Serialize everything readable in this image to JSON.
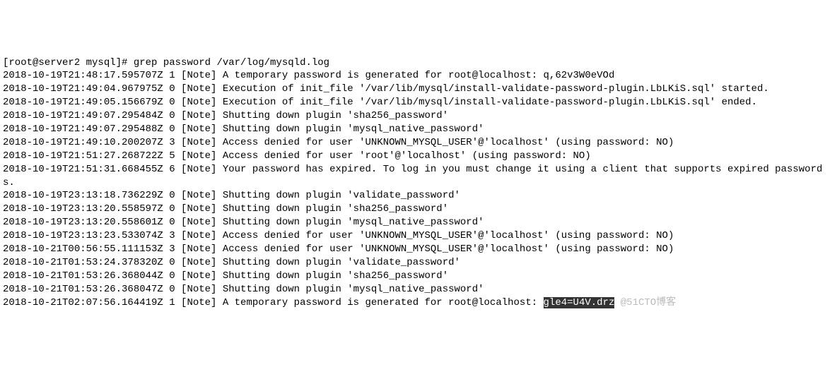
{
  "prompt": "[root@server2 mysql]# grep password /var/log/mysqld.log",
  "lines": [
    "2018-10-19T21:48:17.595707Z 1 [Note] A temporary password is generated for root@localhost: q,62v3W0eVOd",
    "2018-10-19T21:49:04.967975Z 0 [Note] Execution of init_file '/var/lib/mysql/install-validate-password-plugin.LbLKiS.sql' started.",
    "2018-10-19T21:49:05.156679Z 0 [Note] Execution of init_file '/var/lib/mysql/install-validate-password-plugin.LbLKiS.sql' ended.",
    "2018-10-19T21:49:07.295484Z 0 [Note] Shutting down plugin 'sha256_password'",
    "2018-10-19T21:49:07.295488Z 0 [Note] Shutting down plugin 'mysql_native_password'",
    "2018-10-19T21:49:10.200207Z 3 [Note] Access denied for user 'UNKNOWN_MYSQL_USER'@'localhost' (using password: NO)",
    "2018-10-19T21:51:27.268722Z 5 [Note] Access denied for user 'root'@'localhost' (using password: NO)",
    "2018-10-19T21:51:31.668455Z 6 [Note] Your password has expired. To log in you must change it using a client that supports expired passwords.",
    "2018-10-19T23:13:18.736229Z 0 [Note] Shutting down plugin 'validate_password'",
    "2018-10-19T23:13:20.558597Z 0 [Note] Shutting down plugin 'sha256_password'",
    "2018-10-19T23:13:20.558601Z 0 [Note] Shutting down plugin 'mysql_native_password'",
    "2018-10-19T23:13:23.533074Z 3 [Note] Access denied for user 'UNKNOWN_MYSQL_USER'@'localhost' (using password: NO)",
    "2018-10-21T00:56:55.111153Z 3 [Note] Access denied for user 'UNKNOWN_MYSQL_USER'@'localhost' (using password: NO)",
    "2018-10-21T01:53:24.378320Z 0 [Note] Shutting down plugin 'validate_password'",
    "2018-10-21T01:53:26.368044Z 0 [Note] Shutting down plugin 'sha256_password'",
    "2018-10-21T01:53:26.368047Z 0 [Note] Shutting down plugin 'mysql_native_password'"
  ],
  "last_line_prefix": "2018-10-21T02:07:56.164419Z 1 [Note] A temporary password is generated for root@localhost: ",
  "last_line_highlight": "gle4=U4V.drz",
  "watermark": " @51CTO博客"
}
